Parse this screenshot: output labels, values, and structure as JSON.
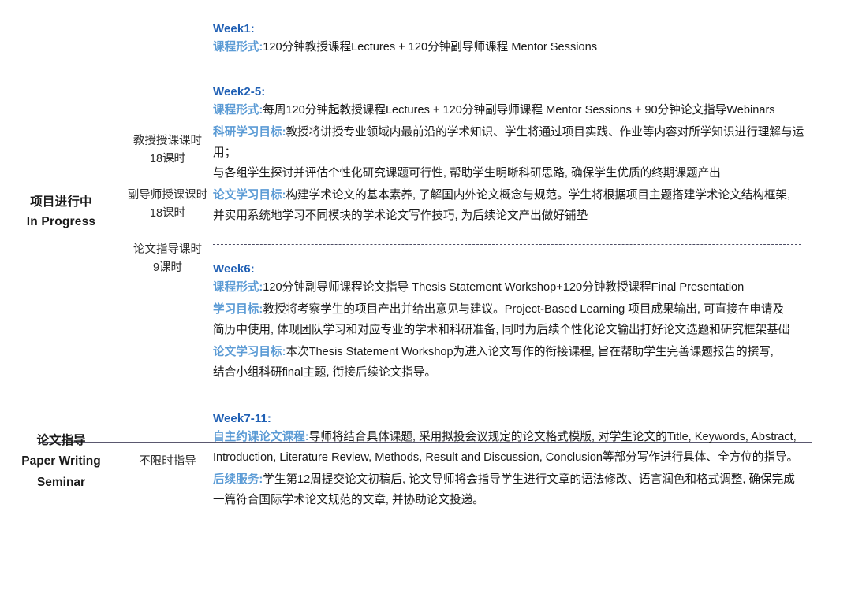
{
  "colors": {
    "week_heading": "#1f5fb4",
    "field_label": "#5b9bd5",
    "body_text": "#1a1a1a",
    "solid_divider": "#5a586f",
    "dashed_divider": "#4b4b63",
    "background": "#ffffff"
  },
  "sections": [
    {
      "stage": {
        "cn": "项目进行中",
        "en": "In Progress"
      },
      "hours": [
        {
          "title": "教授授课课时",
          "value": "18课时"
        },
        {
          "title": "副导师授课课时",
          "value": "18课时"
        },
        {
          "title": "论文指导课时",
          "value": "9课时"
        }
      ],
      "groups": [
        {
          "week": "Week1:",
          "blocks": [
            {
              "label": "课程形式:",
              "lines": [
                "120分钟教授课程Lectures + 120分钟副导师课程  Mentor Sessions"
              ]
            }
          ]
        },
        {
          "week": "Week2-5:",
          "blocks": [
            {
              "label": "课程形式:",
              "lines": [
                "每周120分钟起教授课程Lectures + 120分钟副导师课程  Mentor Sessions + 90分钟论文指导Webinars"
              ]
            },
            {
              "label": "科研学习目标:",
              "lines": [
                "教授将讲授专业领域内最前沿的学术知识、学生将通过项目实践、作业等内容对所学知识进行理解与运用；",
                "与各组学生探讨并评估个性化研究课题可行性, 帮助学生明晰科研思路, 确保学生优质的终期课题产出"
              ]
            },
            {
              "label": "论文学习目标:",
              "lines": [
                "构建学术论文的基本素养, 了解国内外论文概念与规范。学生将根据项目主题搭建学术论文结构框架,",
                "并实用系统地学习不同模块的学术论文写作技巧, 为后续论文产出做好铺垫"
              ]
            }
          ]
        },
        {
          "week": "Week6:",
          "blocks": [
            {
              "label": "课程形式:",
              "lines": [
                "120分钟副导师课程论文指导  Thesis Statement Workshop+120分钟教授课程Final Presentation"
              ]
            },
            {
              "label": "学习目标:",
              "lines": [
                "教授将考察学生的项目产出并给出意见与建议。Project-Based Learning 项目成果输出, 可直接在申请及",
                "简历中使用, 体现团队学习和对应专业的学术和科研准备, 同时为后续个性化论文输出打好论文选题和研究框架基础"
              ]
            },
            {
              "label": "论文学习目标:",
              "lines": [
                "本次Thesis Statement Workshop为进入论文写作的衔接课程, 旨在帮助学生完善课题报告的撰写,",
                "结合小组科研final主题, 衔接后续论文指导。"
              ]
            }
          ]
        }
      ]
    },
    {
      "stage": {
        "cn": "论文指导",
        "en": "Paper Writing",
        "en2": "Seminar"
      },
      "hours": [
        {
          "title": "不限时指导",
          "value": ""
        }
      ],
      "groups": [
        {
          "week": "Week7-11:",
          "blocks": [
            {
              "label": "自主约课论文课程:",
              "lines": [
                "导师将结合具体课题, 采用拟投会议规定的论文格式模版, 对学生论文的Title, Keywords, Abstract,",
                "Introduction, Literature Review, Methods, Result and Discussion, Conclusion等部分写作进行具体、全方位的指导。"
              ]
            },
            {
              "label": "后续服务:",
              "lines": [
                "学生第12周提交论文初稿后, 论文导师将会指导学生进行文章的语法修改、语言润色和格式调整, 确保完成",
                "一篇符合国际学术论文规范的文章, 并协助论文投递。"
              ]
            }
          ]
        }
      ]
    }
  ]
}
